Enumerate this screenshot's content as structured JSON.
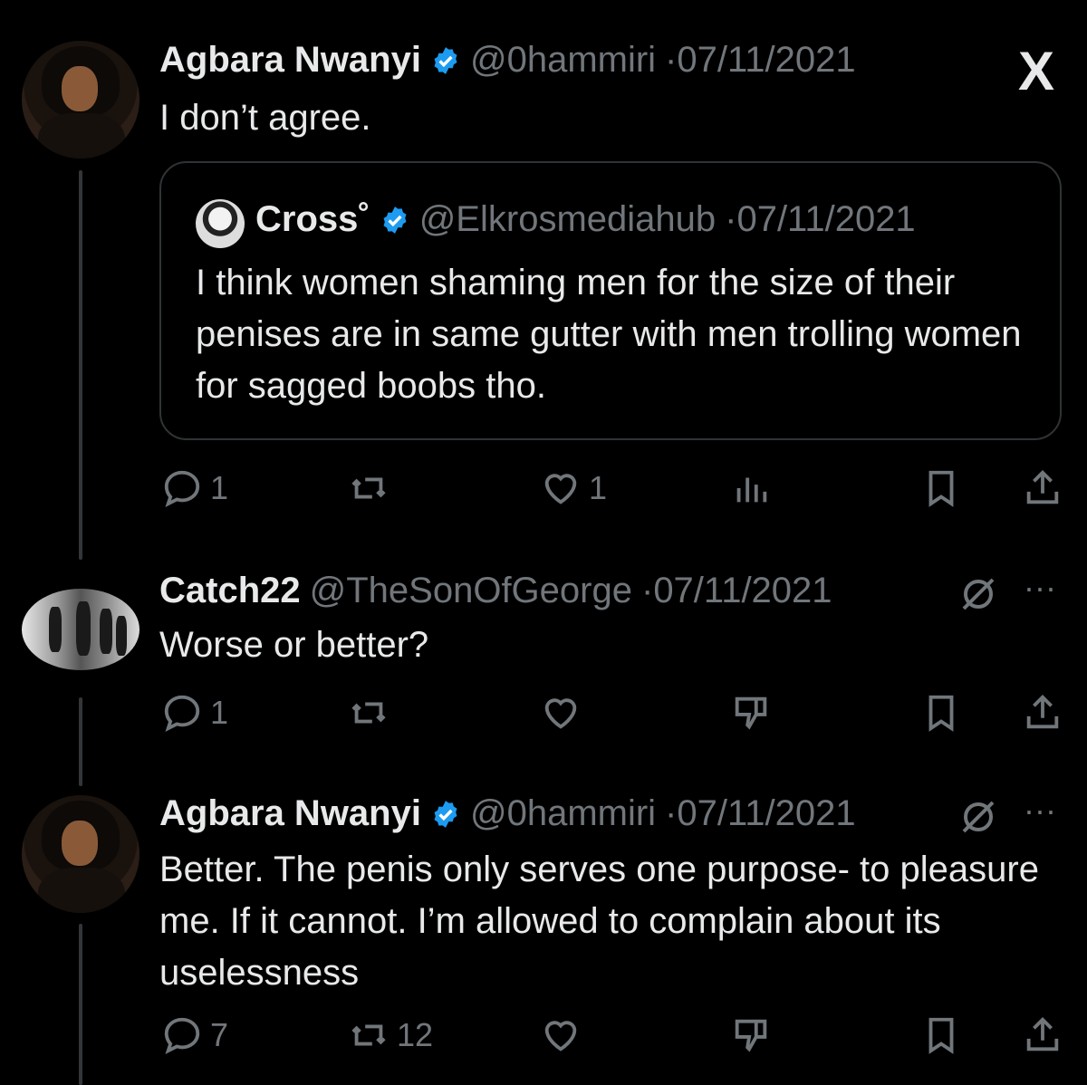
{
  "tweets": [
    {
      "name": "Agbara Nwanyi",
      "handle": "@0hammiri",
      "sep": "·",
      "date": "07/11/2021",
      "text": "I don’t agree.",
      "quote": {
        "name": "Cross˚",
        "handle": "@Elkrosmediahub",
        "sep": "·",
        "date": "07/11/2021",
        "text": "I think women shaming men for the size of their penises are in same gutter with men trolling women for sagged boobs tho."
      },
      "replies": "1",
      "likes": "1"
    },
    {
      "name": "Catch22",
      "handle": "@TheSonOfGeorge",
      "sep": "·",
      "date": "07/11/2021",
      "text": "Worse or better?",
      "replies": "1"
    },
    {
      "name": "Agbara Nwanyi",
      "handle": "@0hammiri",
      "sep": "·",
      "date": "07/11/2021",
      "text": "Better. The penis only serves one purpose- to pleasure me. If it cannot. I’m allowed to complain about its uselessness",
      "replies": "7",
      "reposts": "12"
    }
  ],
  "brand": {
    "logo": "X"
  },
  "more": "···",
  "colors": {
    "background": "#000000",
    "text": "#e7e9ea",
    "muted": "#71767b",
    "verified": "#1d9bf0",
    "border": "#2f3336"
  }
}
